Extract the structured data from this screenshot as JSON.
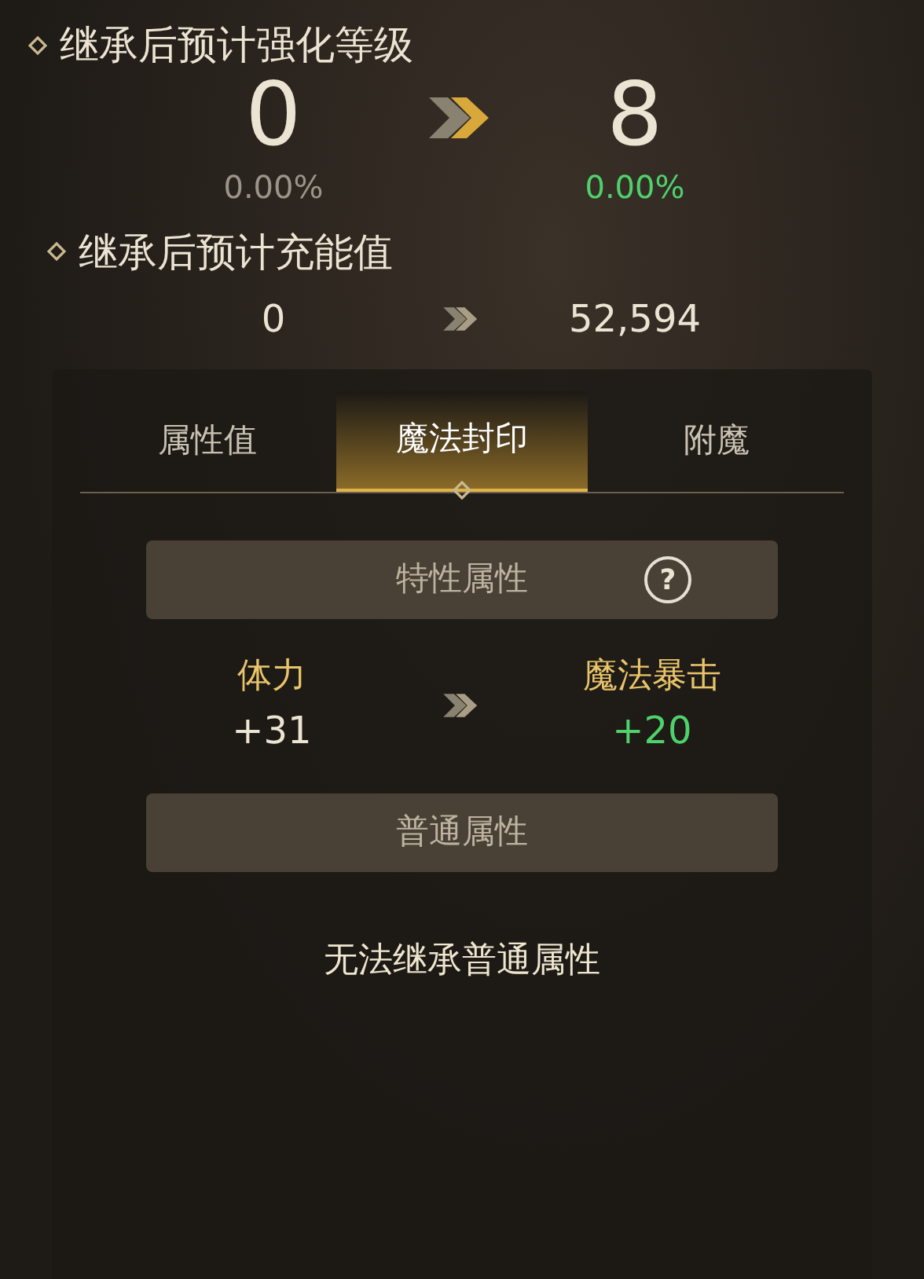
{
  "level_section": {
    "title": "继承后预计强化等级",
    "before": {
      "value": "0",
      "percent": "0.00%"
    },
    "after": {
      "value": "8",
      "percent": "0.00%"
    }
  },
  "charge_section": {
    "title": "继承后预计充能值",
    "before": "0",
    "after": "52,594"
  },
  "tabs": [
    {
      "label": "属性值",
      "selected": false
    },
    {
      "label": "魔法封印",
      "selected": true
    },
    {
      "label": "附魔",
      "selected": false
    }
  ],
  "special_bar": {
    "title": "特性属性",
    "help": "?"
  },
  "transfer": {
    "from_name": "体力",
    "from_value": "+31",
    "to_name": "魔法暴击",
    "to_value": "+20"
  },
  "normal_bar": {
    "title": "普通属性"
  },
  "note": "无法继承普通属性"
}
